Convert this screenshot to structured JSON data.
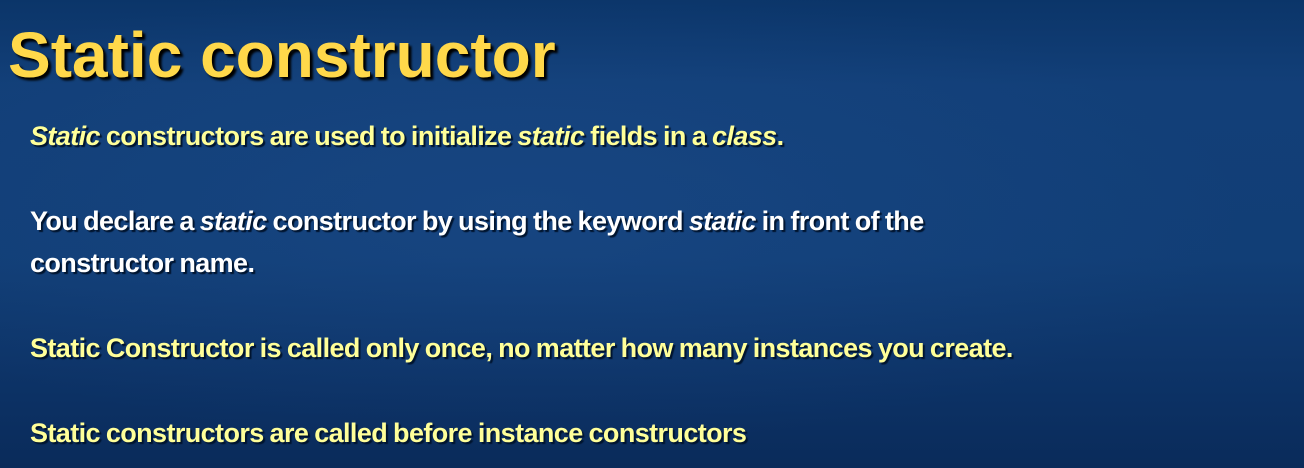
{
  "slide": {
    "title": "Static constructor",
    "p1": {
      "s1": "Static",
      "s2": " constructors are used to initialize ",
      "s3": "static",
      "s4": " fields in a ",
      "s5": "class",
      "s6": "."
    },
    "p2": {
      "s1": "You declare a ",
      "s2": "static",
      "s3": " constructor by using the keyword ",
      "s4": "static",
      "s5": " in front of the",
      "s6": "constructor name."
    },
    "p3": "Static Constructor is called only once, no matter how many instances you create.",
    "p4": "Static constructors are called before instance constructors",
    "colors": {
      "background": "#113e76",
      "title": "#ffd84a",
      "highlight_text": "#ffff99",
      "body_text": "#ffffff"
    }
  }
}
